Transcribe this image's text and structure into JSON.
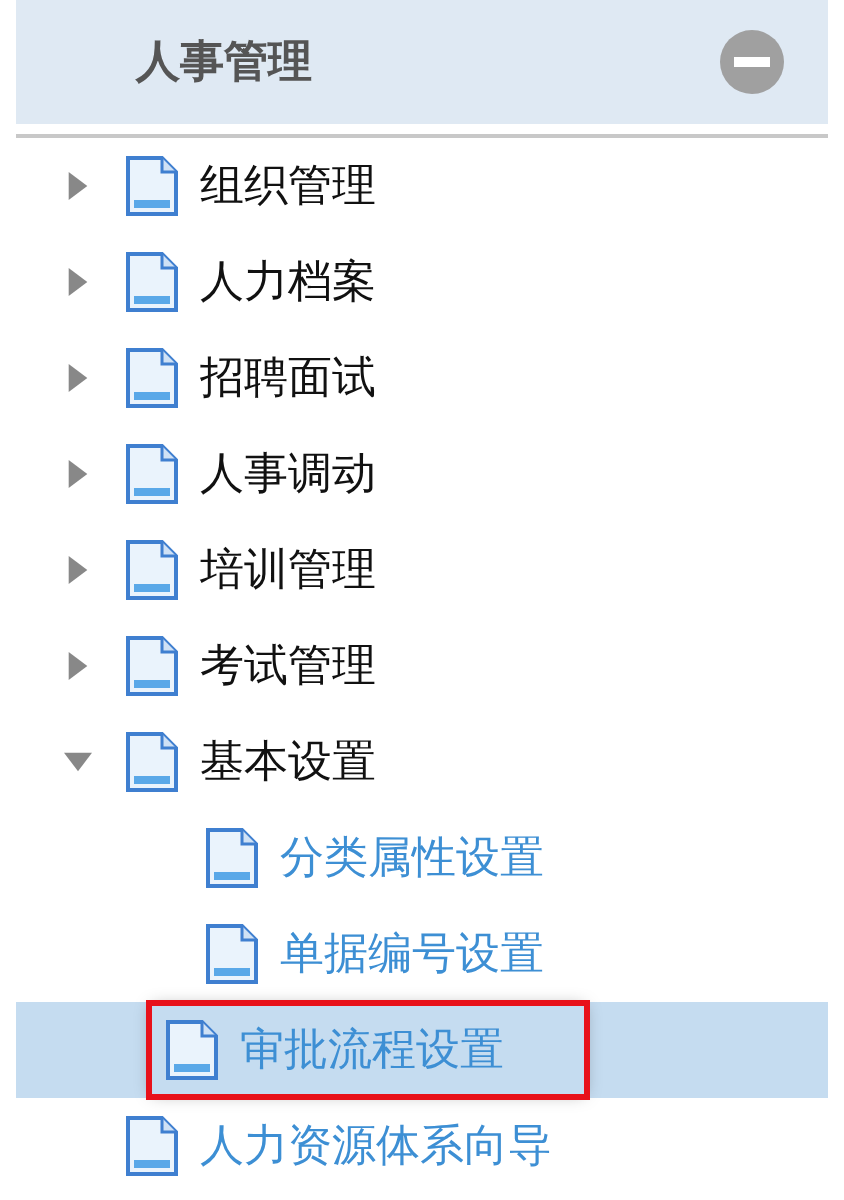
{
  "panel": {
    "title": "人事管理",
    "collapsed": false
  },
  "tree": [
    {
      "label": "组织管理",
      "expanded": false,
      "selected": false
    },
    {
      "label": "人力档案",
      "expanded": false,
      "selected": false
    },
    {
      "label": "招聘面试",
      "expanded": false,
      "selected": false
    },
    {
      "label": "人事调动",
      "expanded": false,
      "selected": false
    },
    {
      "label": "培训管理",
      "expanded": false,
      "selected": false
    },
    {
      "label": "考试管理",
      "expanded": false,
      "selected": false
    },
    {
      "label": "基本设置",
      "expanded": true,
      "selected": false,
      "children": [
        {
          "label": "分类属性设置",
          "selected": false,
          "highlighted": false
        },
        {
          "label": "单据编号设置",
          "selected": false,
          "highlighted": false
        },
        {
          "label": "审批流程设置",
          "selected": true,
          "highlighted": true
        }
      ]
    },
    {
      "label": "人力资源体系向导",
      "kind": "leaf",
      "selected": false
    }
  ]
}
